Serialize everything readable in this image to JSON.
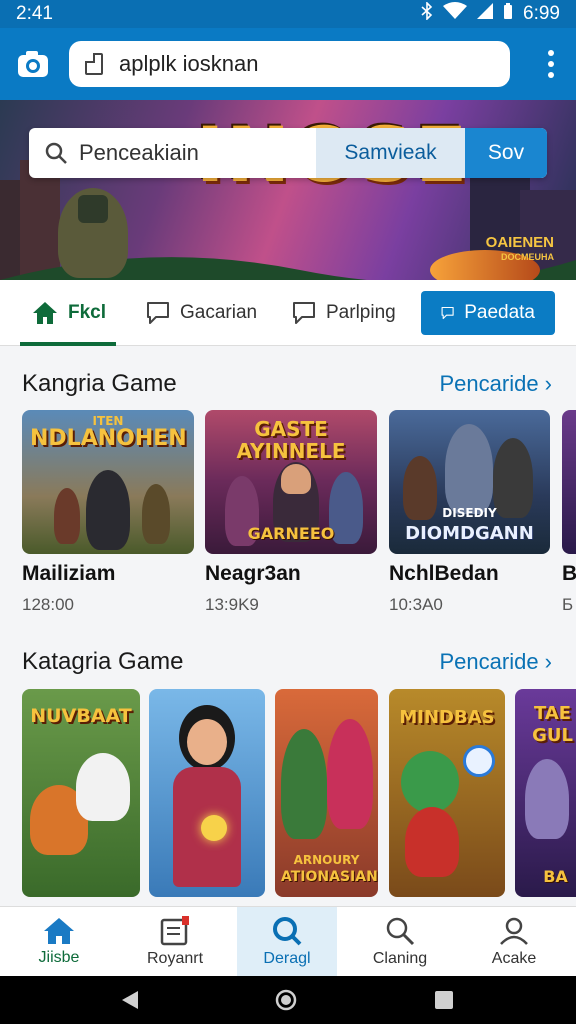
{
  "status_bar": {
    "time": "2:41",
    "battery": "6:99"
  },
  "address_bar": {
    "url": "aplplk iosknan"
  },
  "hero": {
    "banner_title": "INOSE",
    "badge_line1": "OAIENEN",
    "badge_line2": "DOCMEUHA"
  },
  "search": {
    "placeholder": "Penceakiain",
    "button1": "Samvieak",
    "button2": "Sov"
  },
  "tabs": [
    {
      "label": "Fkcl",
      "icon": "home-icon",
      "active": true
    },
    {
      "label": "Gacarian",
      "icon": "chat-icon"
    },
    {
      "label": "Parlping",
      "icon": "chat-icon"
    },
    {
      "label": "Paedata",
      "icon": "chat-icon"
    }
  ],
  "section1": {
    "title": "Kangria Game",
    "link": "Pencaride ›",
    "games": [
      {
        "name": "Mailiziam",
        "meta": "128:00",
        "art_title": "NDLANOHEN",
        "art_top": "ITEN"
      },
      {
        "name": "Neagr3an",
        "meta": "13:9K9",
        "art_title": "GASTE AYINNELE",
        "art_sub": "GARNEEO"
      },
      {
        "name": "NchlBedan",
        "meta": "10:3A0",
        "art_sub": "DIOMDGANN",
        "art_top": "DISEDIY"
      },
      {
        "name": "B",
        "meta": "Б"
      }
    ]
  },
  "section2": {
    "title": "Katagria Game",
    "link": "Pencaride ›",
    "games": [
      {
        "art_title": "NUVBAAT"
      },
      {
        "art_title": ""
      },
      {
        "art_top": "ARNOURY",
        "art_sub": "ATIONASIAN"
      },
      {
        "art_title": "MINDBAS"
      },
      {
        "art_title": "TAE GUL",
        "art_sub": "BA"
      }
    ]
  },
  "bottom_nav": [
    {
      "label": "Jiisbe",
      "icon": "home-icon"
    },
    {
      "label": "Royanrt",
      "icon": "document-icon"
    },
    {
      "label": "Deragl",
      "icon": "search-icon"
    },
    {
      "label": "Claning",
      "icon": "search-icon"
    },
    {
      "label": "Acake",
      "icon": "account-icon"
    }
  ],
  "colors": {
    "primary": "#0a7ac4",
    "accent_green": "#0e6b3a"
  }
}
